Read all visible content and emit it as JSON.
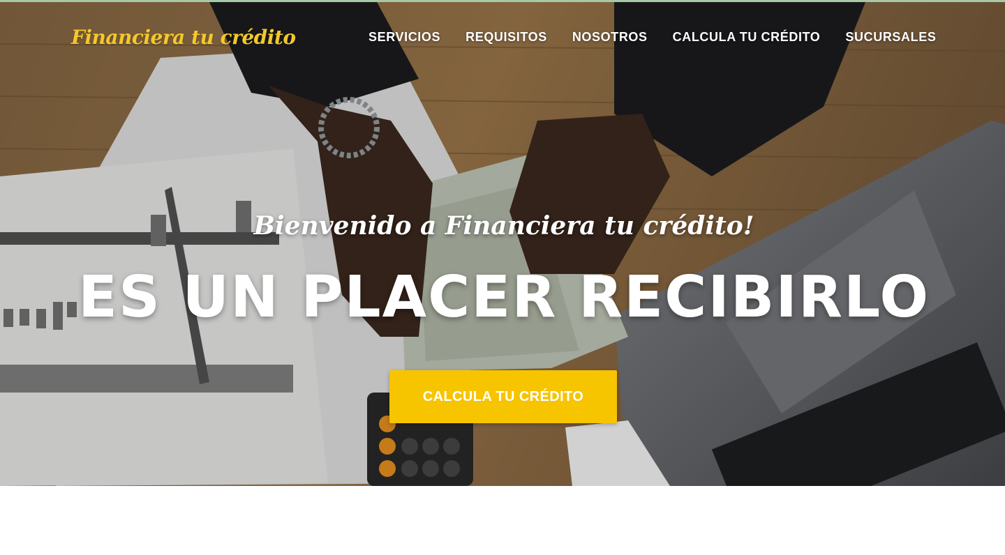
{
  "brand": {
    "logo_text": "Financiera tu crédito",
    "logo_color": "#f4c82b"
  },
  "nav": {
    "items": [
      {
        "label": "SERVICIOS"
      },
      {
        "label": "REQUISITOS"
      },
      {
        "label": "NOSOTROS"
      },
      {
        "label": "CALCULA TU CRÉDITO"
      },
      {
        "label": "SUCURSALES"
      }
    ]
  },
  "hero": {
    "welcome": "Bienvenido a Financiera tu crédito!",
    "headline": "ES UN PLACER RECIBIRLO",
    "cta_label": "CALCULA TU CRÉDITO",
    "cta_color": "#f7c400",
    "background_image": "hands-counting-dollar-bills-on-desk-with-laptop-calculator-and-documents"
  }
}
